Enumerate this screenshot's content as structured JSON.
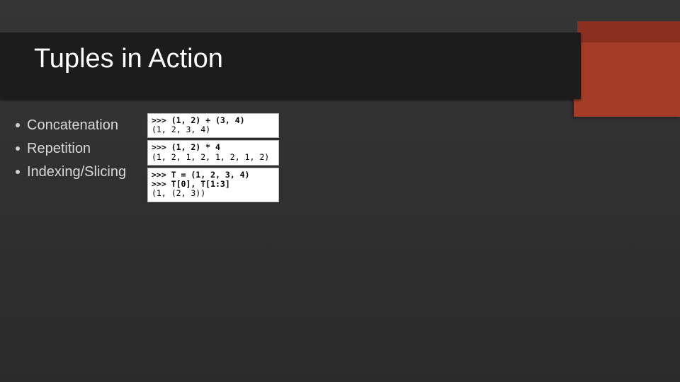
{
  "title": "Tuples in Action",
  "bullets": [
    "Concatenation",
    "Repetition",
    "Indexing/Slicing"
  ],
  "code": [
    {
      "in": ">>> (1, 2) + (3, 4)",
      "out": "(1, 2, 3, 4)"
    },
    {
      "in": ">>> (1, 2) * 4",
      "out": "(1, 2, 1, 2, 1, 2, 1, 2)"
    },
    {
      "in1": ">>> T = (1, 2, 3, 4)",
      "in2": ">>> T[0], T[1:3]",
      "out": "(1, (2, 3))"
    }
  ]
}
